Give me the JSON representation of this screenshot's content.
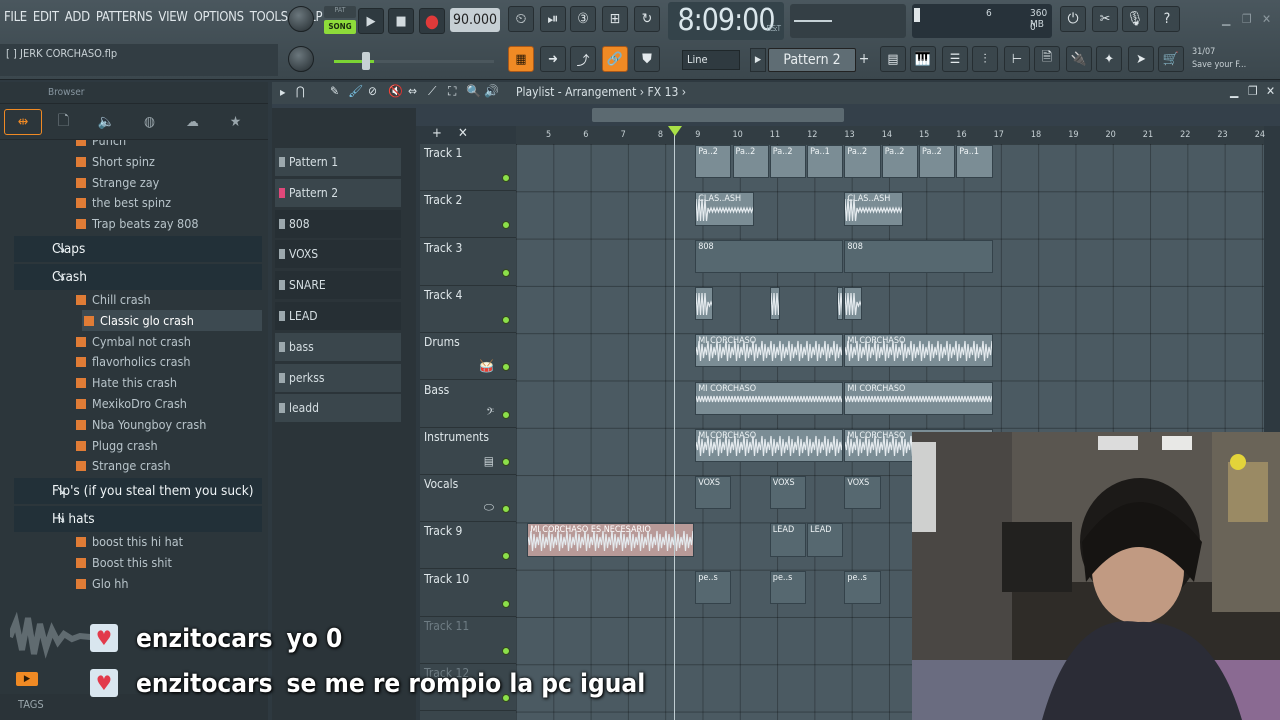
{
  "menu": [
    "FILE",
    "EDIT",
    "ADD",
    "PATTERNS",
    "VIEW",
    "OPTIONS",
    "TOOLS",
    "HELP"
  ],
  "transport": {
    "pat_label": "PAT",
    "song_label": "SONG",
    "tempo": "90.000",
    "time": "8:09:00",
    "time_unit": "B:S:T"
  },
  "cpu": {
    "value": "6",
    "memory": "360 MB",
    "polyphony": "0"
  },
  "file": {
    "name": "JERK CORCHASO.flp",
    "bracket": "[ ]"
  },
  "toolbar": {
    "snap": "Line",
    "pattern": "Pattern 2",
    "hint_date": "31/07",
    "hint_text": "Save your F..."
  },
  "browser": {
    "title": "Browser",
    "items": [
      {
        "type": "file",
        "label": "Punch"
      },
      {
        "type": "file",
        "label": "Short spinz"
      },
      {
        "type": "file",
        "label": "Strange zay"
      },
      {
        "type": "file",
        "label": "the best spinz"
      },
      {
        "type": "file",
        "label": "Trap beats zay 808"
      },
      {
        "type": "folder",
        "label": "Claps"
      },
      {
        "type": "folder",
        "label": "Crash"
      },
      {
        "type": "file",
        "label": "Chill crash"
      },
      {
        "type": "sel",
        "label": "Classic glo crash"
      },
      {
        "type": "file",
        "label": "Cymbal not crash"
      },
      {
        "type": "file",
        "label": "flavorholics crash"
      },
      {
        "type": "file",
        "label": "Hate this crash"
      },
      {
        "type": "file",
        "label": "MexikoDro Crash"
      },
      {
        "type": "file",
        "label": "Nba Youngboy crash"
      },
      {
        "type": "file",
        "label": "Plugg crash"
      },
      {
        "type": "file",
        "label": "Strange crash"
      },
      {
        "type": "folder",
        "label": "Flp's (if you steal them you suck)"
      },
      {
        "type": "folder",
        "label": "Hi hats"
      },
      {
        "type": "file",
        "label": "boost this hi hat"
      },
      {
        "type": "file",
        "label": "Boost this shit"
      },
      {
        "type": "file",
        "label": "Glo hh"
      }
    ],
    "tags_label": "TAGS"
  },
  "playlist": {
    "title": "Playlist - Arrangement",
    "fx": "FX 13",
    "patterns": [
      "Pattern 1",
      "Pattern 2",
      "808",
      "VOXS",
      "SNARE",
      "LEAD",
      "bass",
      "perkss",
      "leadd"
    ],
    "tracks": [
      {
        "name": "Track 1",
        "icon": ""
      },
      {
        "name": "Track 2",
        "icon": ""
      },
      {
        "name": "Track 3",
        "icon": ""
      },
      {
        "name": "Track 4",
        "icon": ""
      },
      {
        "name": "Drums",
        "icon": "drum-icon"
      },
      {
        "name": "Bass",
        "icon": "bass-clef-icon"
      },
      {
        "name": "Instruments",
        "icon": "keys-icon"
      },
      {
        "name": "Vocals",
        "icon": "lips-icon"
      },
      {
        "name": "Track 9",
        "icon": ""
      },
      {
        "name": "Track 10",
        "icon": ""
      },
      {
        "name": "Track 11",
        "icon": ""
      },
      {
        "name": "Track 12",
        "icon": ""
      }
    ],
    "bars": [
      "5",
      "6",
      "7",
      "8",
      "9",
      "10",
      "11",
      "12",
      "13",
      "14",
      "15",
      "16",
      "17",
      "18",
      "19",
      "20",
      "21",
      "22",
      "23",
      "24"
    ],
    "playhead_bar": 8.5,
    "clips": {
      "t1": [
        "Pa..2",
        "Pa..2",
        "Pa..2",
        "Pa..1",
        "Pa..2",
        "Pa..2",
        "Pa..2",
        "Pa..1"
      ],
      "t2": [
        "CLAS..ASH",
        "CLAS..ASH"
      ],
      "t3": [
        "808",
        "808"
      ],
      "drums": [
        "MI CORCHASO",
        "MI CORCHASO"
      ],
      "bass": [
        "MI CORCHASO",
        "MI CORCHASO"
      ],
      "inst": [
        "MI CORCHASO",
        "MI CORCHASO"
      ],
      "vocals": [
        "VOXS",
        "VOXS",
        "VOXS"
      ],
      "t9a": "MI CORCHASO ES NECESARIO",
      "t9b": [
        "LEAD",
        "LEAD"
      ],
      "t10": [
        "pe..s",
        "pe..s",
        "pe..s"
      ]
    }
  },
  "chat": [
    {
      "user": "enzitocars",
      "message": "yo 0"
    },
    {
      "user": "enzitocars",
      "message": "se me re rompio la pc igual"
    }
  ],
  "colors": {
    "accent": "#f08a24",
    "song": "#8edb3a",
    "led": "#8ce04a",
    "rec": "#e03a3a"
  }
}
